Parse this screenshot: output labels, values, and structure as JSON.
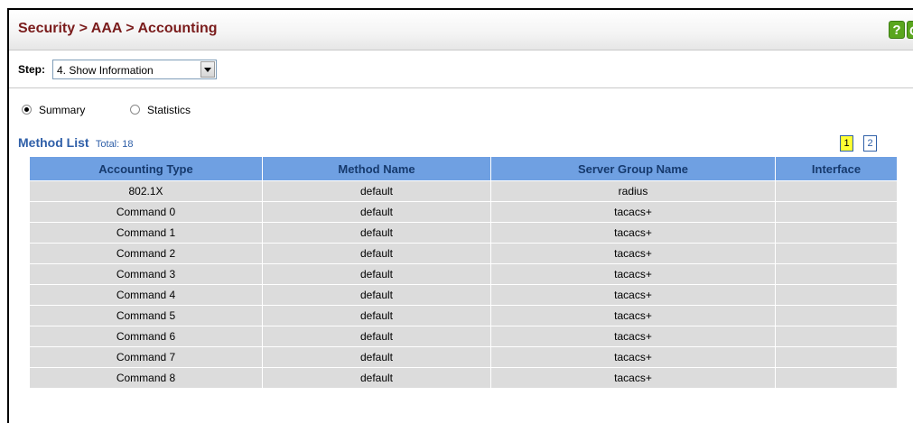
{
  "header": {
    "title": "Security > AAA > Accounting",
    "help_label": "?",
    "extra_icon_label": "C"
  },
  "step": {
    "label": "Step:",
    "selected": "4. Show Information"
  },
  "view": {
    "options": [
      {
        "label": "Summary",
        "checked": true
      },
      {
        "label": "Statistics",
        "checked": false
      }
    ]
  },
  "method_list": {
    "title": "Method List",
    "total": "Total: 18",
    "pages": [
      "1",
      "2"
    ],
    "current_page": "1",
    "columns": [
      "Accounting Type",
      "Method Name",
      "Server Group Name",
      "Interface"
    ],
    "rows": [
      [
        "802.1X",
        "default",
        "radius",
        ""
      ],
      [
        "Command 0",
        "default",
        "tacacs+",
        ""
      ],
      [
        "Command 1",
        "default",
        "tacacs+",
        ""
      ],
      [
        "Command 2",
        "default",
        "tacacs+",
        ""
      ],
      [
        "Command 3",
        "default",
        "tacacs+",
        ""
      ],
      [
        "Command 4",
        "default",
        "tacacs+",
        ""
      ],
      [
        "Command 5",
        "default",
        "tacacs+",
        ""
      ],
      [
        "Command 6",
        "default",
        "tacacs+",
        ""
      ],
      [
        "Command 7",
        "default",
        "tacacs+",
        ""
      ],
      [
        "Command 8",
        "default",
        "tacacs+",
        ""
      ]
    ]
  },
  "colors": {
    "title": "#7a1c1c",
    "accent": "#2f5fa8",
    "table_header": "#6fa0e2",
    "row_bg": "#dcdcdc",
    "current_page": "#ffff33"
  }
}
